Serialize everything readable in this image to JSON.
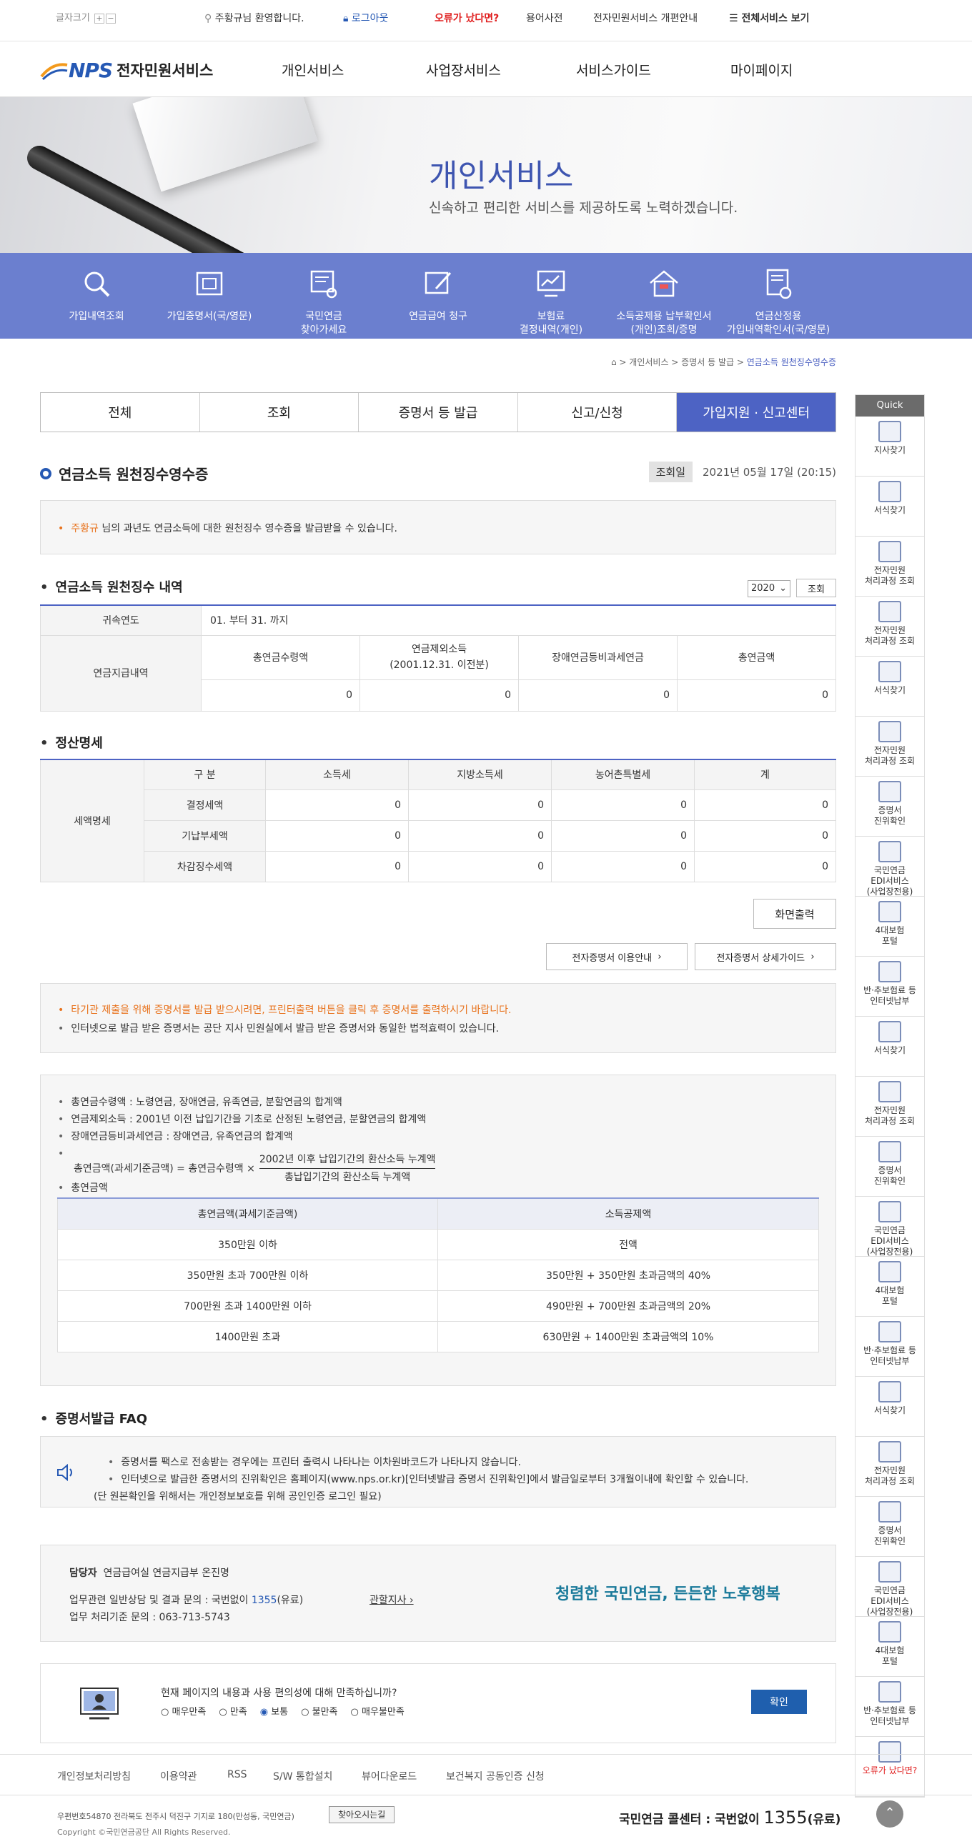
{
  "util": {
    "font_size": "글자크기",
    "plus": "+",
    "minus": "−",
    "welcome": "주황규님 환영합니다.",
    "logout": "로그아웃",
    "error": "오류가 났다면?",
    "glossary": "용어사전",
    "renewal": "전자민원서비스 개편안내",
    "all": "전체서비스 보기"
  },
  "gnb": {
    "logo_nps": "NPS",
    "logo_text": "전자민원서비스",
    "menu": [
      "개인서비스",
      "사업장서비스",
      "서비스가이드",
      "마이페이지"
    ]
  },
  "hero": {
    "title": "개인서비스",
    "subtitle": "신속하고 편리한 서비스를 제공하도록 노력하겠습니다."
  },
  "quickbar": [
    {
      "l1": "가입내역조회",
      "l2": ""
    },
    {
      "l1": "가입증명서(국/영문)",
      "l2": ""
    },
    {
      "l1": "국민연금",
      "l2": "찾아가세요"
    },
    {
      "l1": "연금급여 청구",
      "l2": ""
    },
    {
      "l1": "보험료",
      "l2": "결정내역(개인)"
    },
    {
      "l1": "소득공제용 납부확인서",
      "l2": "(개인)조회/증명"
    },
    {
      "l1": "연금산정용",
      "l2": "가입내역확인서(국/영문)"
    }
  ],
  "breadcrumb": {
    "home": "⌂",
    "b1": "개인서비스",
    "b2": "증명서 등 발급",
    "cur": "연금소득 원천징수영수증"
  },
  "tabs": [
    "전체",
    "조회",
    "증명서 등 발급",
    "신고/신청",
    "가입지원 · 신고센터"
  ],
  "page": {
    "title": "연금소득 원천징수영수증",
    "date_label": "조회일",
    "date_value": "2021년 05월 17일 (20:15)",
    "notice_name": "주황규",
    "notice_rest": " 님의 과년도 연금소득에 대한 원천징수 영수증을 발급받을 수 있습니다."
  },
  "s1": {
    "title": "연금소득 원천징수 내역",
    "year": "2020",
    "btn": "조회",
    "r_year": "귀속연도",
    "r_year_val": "01. 부터 31. 까지",
    "r_pay": "연금지급내역",
    "h1": "총연금수령액",
    "h2a": "연금제외소득",
    "h2b": "(2001.12.31. 이전분)",
    "h3": "장애연금등비과세연금",
    "h4": "총연금액",
    "vals": [
      "0",
      "0",
      "0",
      "0"
    ]
  },
  "s2": {
    "title": "정산명세",
    "group": "세액명세",
    "cols": [
      "구 분",
      "소득세",
      "지방소득세",
      "농어촌특별세",
      "계"
    ],
    "rows": [
      {
        "label": "결정세액",
        "v": [
          "0",
          "0",
          "0",
          "0"
        ]
      },
      {
        "label": "기납부세액",
        "v": [
          "0",
          "0",
          "0",
          "0"
        ]
      },
      {
        "label": "차감징수세액",
        "v": [
          "0",
          "0",
          "0",
          "0"
        ]
      }
    ]
  },
  "buttons": {
    "print": "화면출력",
    "guide": "전자증명서 이용안내",
    "detail": "전자증명서 상세가이드",
    "arrow": "›"
  },
  "notice2": {
    "l1": "타기관 제출을 위해 증명서를 발급 받으시려면, 프린터출력 버튼을 클릭 후 증명서를 출력하시기 바랍니다.",
    "l2": "인터넷으로 발급 받은 증명서는 공단 지사 민원실에서 발급 받은 증명서와 동일한 법적효력이 있습니다."
  },
  "info": {
    "l1": "총연금수령액 : 노령연금, 장애연금, 유족연금, 분할연금의 합계액",
    "l2": "연금제외소득 : 2001년 이전 납입기간을 기초로 산정된 노령연금, 분할연금의 합계액",
    "l3": "장애연금등비과세연금 : 장애연금, 유족연금의 합계액",
    "formula_left": "총연금액(과세기준금액) = 총연금수령액 ×",
    "formula_num": "2002년 이후 납입기간의 환산소득 누계액",
    "formula_den": "총납입기간의 환산소득 누계액",
    "l5": "총연금액",
    "th1": "총연금액(과세기준금액)",
    "th2": "소득공제액",
    "rows": [
      [
        "350만원 이하",
        "전액"
      ],
      [
        "350만원 초과 700만원 이하",
        "350만원 + 350만원 초과금액의 40%"
      ],
      [
        "700만원 초과 1400만원 이하",
        "490만원 + 700만원 초과금액의 20%"
      ],
      [
        "1400만원 초과",
        "630만원 + 1400만원 초과금액의 10%"
      ]
    ]
  },
  "faq": {
    "title": "증명서발급 FAQ",
    "l1": "증명서를 팩스로 전송받는 경우에는 프린터 출력시 나타나는 이차원바코드가 나타나지 않습니다.",
    "l2": "인터넷으로 발급한 증명서의 진위확인은 홈페이지(www.nps.or.kr)[인터넷발급 증명서 진위확인]에서 발급일로부터 3개월이내에 확인할 수 있습니다.",
    "l3": "(단 원본확인을 위해서는 개인정보보호를 위해 공인인증 로그인 필요)"
  },
  "contact": {
    "label": "담당자",
    "dept": "연금급여실 연금지급부 온진명",
    "q1_pre": "업무관련 일반상담 및 결과 문의 : 국번없이 ",
    "q1_num": "1355",
    "q1_post": "(유료)",
    "branch": "관할지사",
    "q2": "업무 처리기준 문의 : 063-713-5743",
    "slogan": "청렴한 국민연금, 든든한 노후행복"
  },
  "survey": {
    "q": "현재 페이지의 내용과 사용 편의성에 대해 만족하십니까?",
    "opts": [
      "매우만족",
      "만족",
      "보통",
      "불만족",
      "매우불만족"
    ],
    "btn": "확인"
  },
  "quick": {
    "head": "Quick",
    "items": [
      [
        "지사찾기",
        ""
      ],
      [
        "서식찾기",
        ""
      ],
      [
        "전자민원",
        "처리과정 조회"
      ],
      [
        "전자민원",
        "처리과정 조회"
      ],
      [
        "서식찾기",
        ""
      ],
      [
        "전자민원",
        "처리과정 조회"
      ],
      [
        "증명서",
        "진위확인"
      ],
      [
        "국민연금",
        "EDI서비스",
        "(사업장전용)"
      ],
      [
        "4대보험",
        "포털"
      ],
      [
        "반·추보험료 등",
        "인터넷납부"
      ],
      [
        "서식찾기",
        ""
      ],
      [
        "전자민원",
        "처리과정 조회"
      ],
      [
        "증명서",
        "진위확인"
      ],
      [
        "국민연금",
        "EDI서비스",
        "(사업장전용)"
      ],
      [
        "4대보험",
        "포털"
      ],
      [
        "반·추보험료 등",
        "인터넷납부"
      ],
      [
        "서식찾기",
        ""
      ],
      [
        "전자민원",
        "처리과정 조회"
      ],
      [
        "증명서",
        "진위확인"
      ],
      [
        "국민연금",
        "EDI서비스",
        "(사업장전용)"
      ],
      [
        "4대보험",
        "포털"
      ],
      [
        "반·추보험료 등",
        "인터넷납부"
      ],
      [
        "오류가 났다면?",
        ""
      ]
    ]
  },
  "footer": {
    "links": [
      "개인정보처리방침",
      "이용약관",
      "RSS",
      "S/W 통합설치",
      "뷰어다운로드",
      "보건복지 공동인증 신청"
    ],
    "addr": "우편번호54870 전라북도 전주시 덕진구 기지로 180(만성동, 국민연금)",
    "find": "찾아오시는길",
    "copy": "Copyright ©국민연금공단 All Rights Reserved.",
    "call_pre": "국민연금 콜센터 : 국번없이",
    "call_num": "1355",
    "call_post": "(유료)"
  }
}
